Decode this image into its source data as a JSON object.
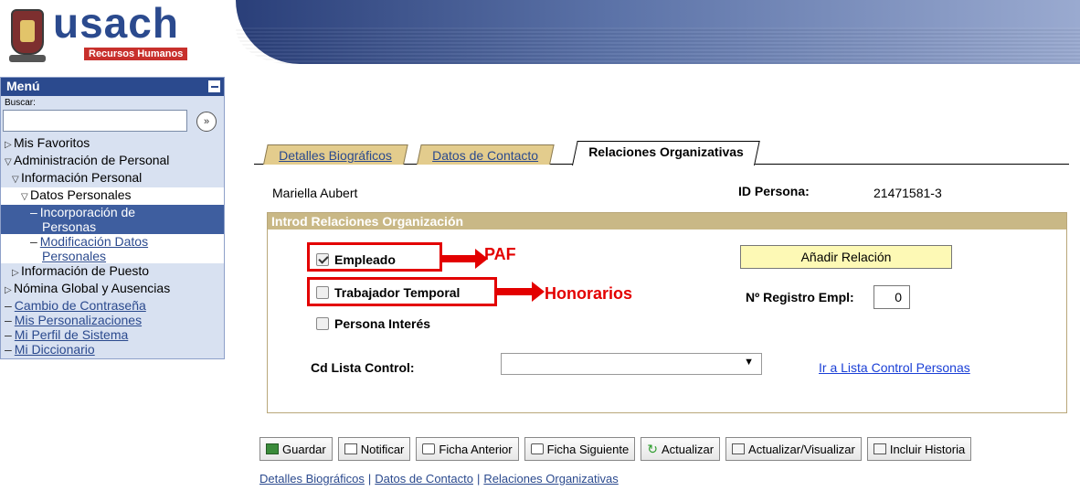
{
  "logo": {
    "name": "usach",
    "subtitle": "Recursos Humanos"
  },
  "menu": {
    "title": "Menú",
    "search_label": "Buscar:",
    "search_value": "",
    "search_go": "»",
    "items": [
      {
        "label": "Mis Favoritos"
      },
      {
        "label": "Administración de Personal"
      },
      {
        "label": "Información Personal"
      },
      {
        "label": "Datos Personales"
      },
      {
        "label": "Incorporación de"
      },
      {
        "label": "Personas"
      },
      {
        "label": "Modificación Datos"
      },
      {
        "label": "Personales"
      },
      {
        "label": "Información de Puesto"
      },
      {
        "label": "Nómina Global y Ausencias"
      },
      {
        "label": "Cambio de Contraseña"
      },
      {
        "label": "Mis Personalizaciones"
      },
      {
        "label": "Mi Perfil de Sistema"
      },
      {
        "label": "Mi Diccionario"
      }
    ]
  },
  "tabs": [
    {
      "label": "Detalles Biográficos"
    },
    {
      "label": "Datos de Contacto"
    },
    {
      "label": "Relaciones Organizativas"
    }
  ],
  "person": {
    "name": "Mariella Aubert",
    "id_label": "ID Persona:",
    "id_value": "21471581-3"
  },
  "section": {
    "title": "Introd Relaciones Organización",
    "checkboxes": [
      {
        "label": "Empleado",
        "checked": true
      },
      {
        "label": "Trabajador Temporal",
        "checked": false
      },
      {
        "label": "Persona Interés",
        "checked": false
      }
    ],
    "add_button": "Añadir Relación",
    "reg_label": "Nº Registro Empl:",
    "reg_value": "0",
    "cd_label": "Cd Lista Control:",
    "cd_value": "",
    "cd_link": "Ir a Lista Control Personas"
  },
  "annotations": {
    "paf": "PAF",
    "honorarios": "Honorarios",
    "color": "#e30000"
  },
  "toolbar": [
    {
      "label": "Guardar"
    },
    {
      "label": "Notificar"
    },
    {
      "label": "Ficha Anterior"
    },
    {
      "label": "Ficha Siguiente"
    },
    {
      "label": "Actualizar"
    },
    {
      "label": "Actualizar/Visualizar"
    },
    {
      "label": "Incluir Historia"
    }
  ],
  "bottom_links": [
    {
      "label": "Detalles Biográficos"
    },
    {
      "label": "Datos de Contacto"
    },
    {
      "label": "Relaciones Organizativas"
    }
  ],
  "bottom_separator": "|",
  "colors": {
    "brand": "#2b4a8e",
    "section_header": "#c9b886",
    "tab": "#e3cc8d"
  }
}
